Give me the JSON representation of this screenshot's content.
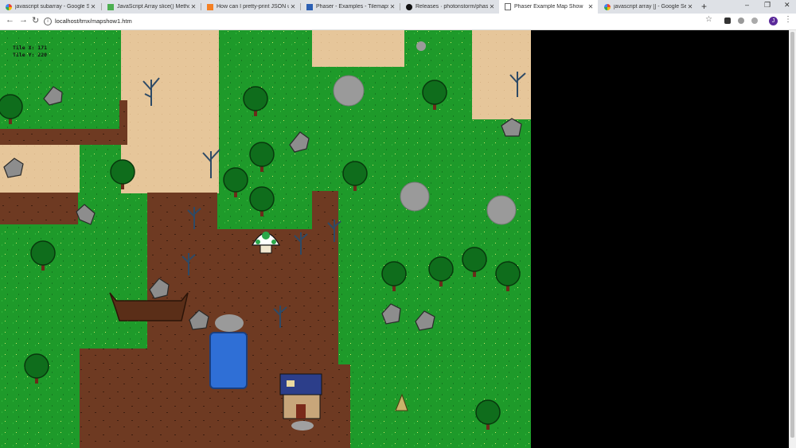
{
  "browser": {
    "tabs": [
      {
        "title": "javascript subarray - Google Sea",
        "icon": "google-icon",
        "active": false
      },
      {
        "title": "JavaScript Array slice() Method",
        "icon": "w3schools-icon",
        "active": false
      },
      {
        "title": "How can I pretty-print JSON usi",
        "icon": "stackoverflow-icon",
        "active": false
      },
      {
        "title": "Phaser - Examples - Tilemaps - F",
        "icon": "phaser-icon",
        "active": false
      },
      {
        "title": "Releases · photonstorm/phaser",
        "icon": "github-icon",
        "active": false
      },
      {
        "title": "Phaser Example Map Show",
        "icon": "page-icon",
        "active": true
      },
      {
        "title": "javascript array [] - Google Sear",
        "icon": "google-icon",
        "active": false
      }
    ],
    "new_tab": "+",
    "window_controls": {
      "minimize": "–",
      "restore": "❐",
      "close": "✕"
    },
    "nav": {
      "back": "←",
      "forward": "→",
      "reload": "↻"
    },
    "url": "localhost/tmx/mapshow1.htm",
    "profile_initial": "J"
  },
  "game": {
    "hud": {
      "tile_x_label": "Tile X: 171",
      "tile_y_label": "Tile Y: 220"
    }
  },
  "colors": {
    "grass": "#1e9a2a",
    "sand": "#e6c69a",
    "dirt": "#6e3a22",
    "water": "#2f6fd6",
    "rock": "#8d8d8d"
  }
}
